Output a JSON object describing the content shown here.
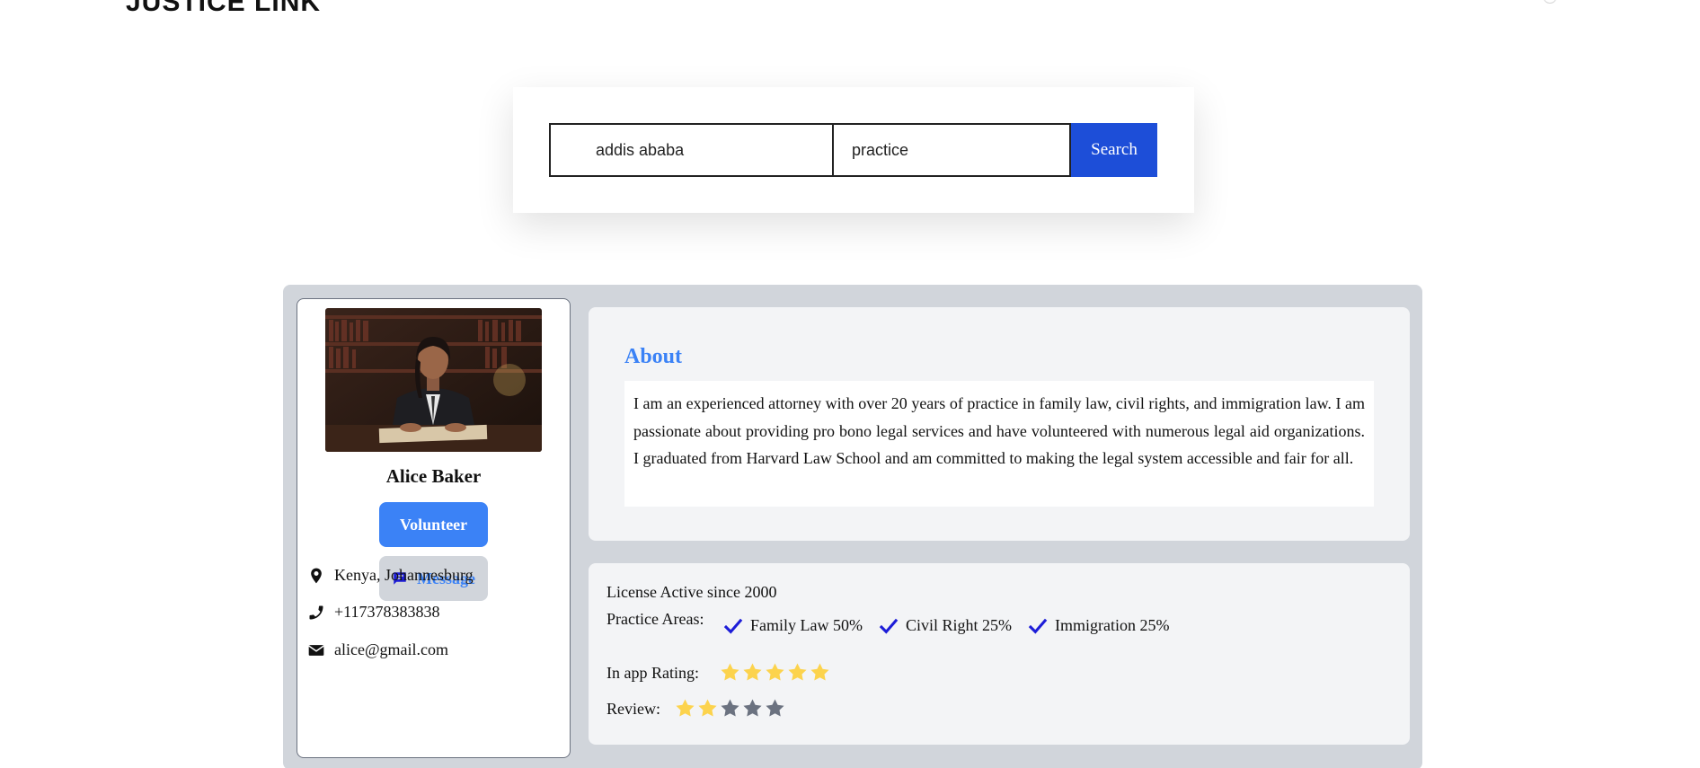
{
  "brand": {
    "name": "JUSTICE LINK"
  },
  "search": {
    "location_value": "addis ababa",
    "practice_value": "practice",
    "button_label": "Search"
  },
  "profile": {
    "name": "Alice Baker",
    "volunteer_label": "Volunteer",
    "message_label": "Message",
    "location": "Kenya, Johannesburg",
    "phone": "+117378383838",
    "email": "alice@gmail.com",
    "photo_icon": "lawyer-portrait-photo"
  },
  "about": {
    "title": "About",
    "text": "I am an experienced attorney with over 20 years of practice in family law, civil rights, and immigration law. I am passionate about providing pro bono legal services and have volunteered with numerous legal aid organizations. I graduated from Harvard Law School and am committed to making the legal system accessible and fair for all."
  },
  "details": {
    "license": "License Active since 2000",
    "practice_label": "Practice Areas:",
    "practice_areas": [
      {
        "label": "Family Law 50%"
      },
      {
        "label": "Civil Right 25%"
      },
      {
        "label": "Immigration 25%"
      }
    ],
    "rating_label": "In app Rating:",
    "rating_value": 5,
    "review_label": "Review:",
    "review_value": 2,
    "max_stars": 5
  },
  "colors": {
    "accent_blue": "#3b82f6",
    "search_button": "#1d4ed8",
    "star_filled": "#fcd34d",
    "star_empty": "#6b7280",
    "check": "#1d1dd8",
    "panel_bg": "#d1d5db",
    "card_bg": "#f3f4f6"
  }
}
